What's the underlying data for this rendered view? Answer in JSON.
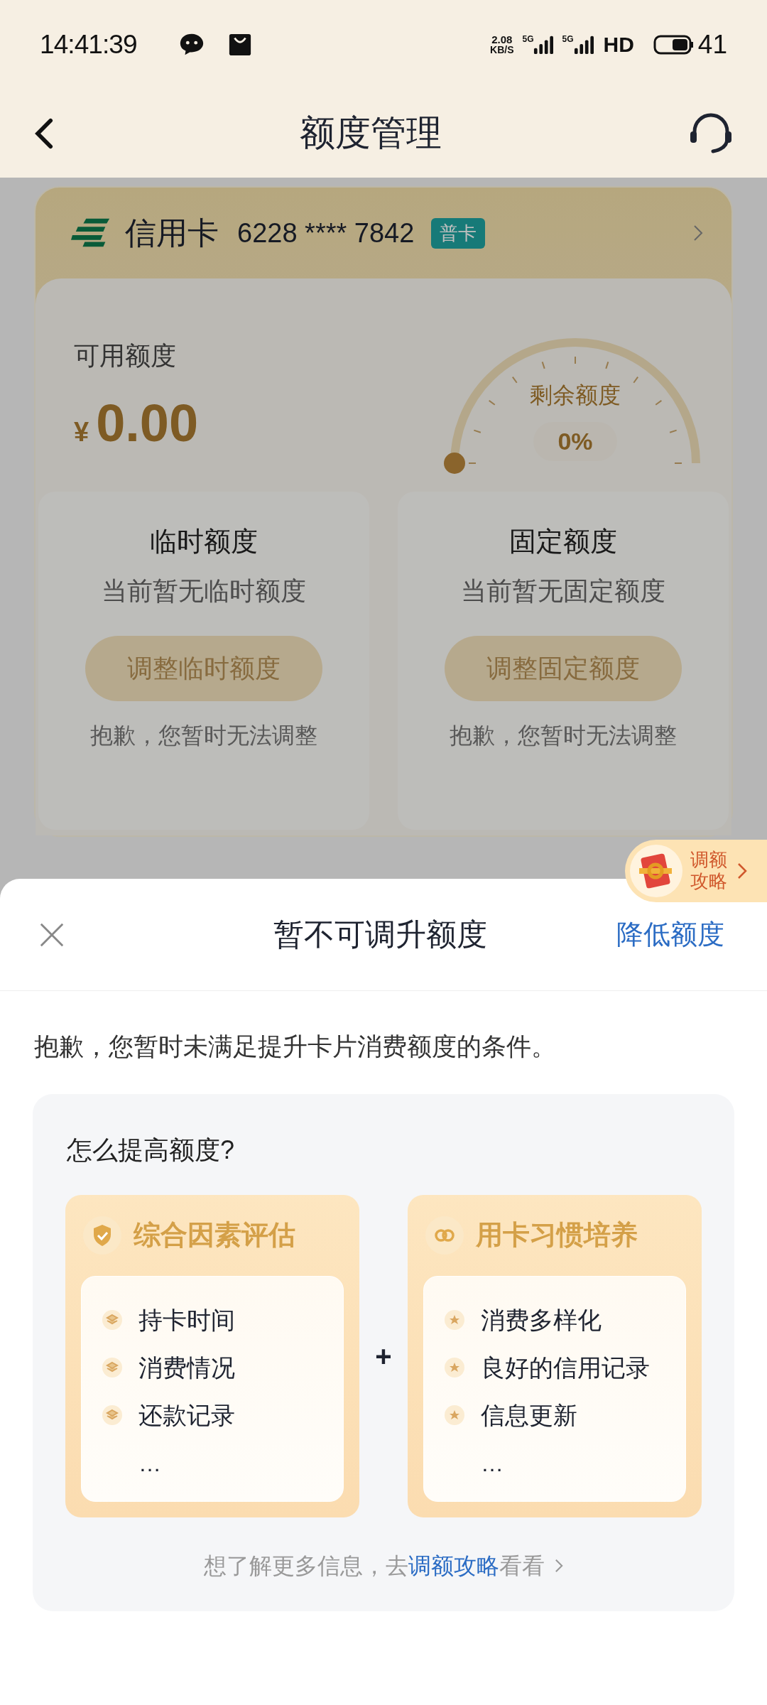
{
  "status_bar": {
    "time": "14:41:39",
    "speed_value": "2.08",
    "speed_unit": "KB/S",
    "networks": [
      "5G",
      "5G"
    ],
    "hd": "HD",
    "battery": "41"
  },
  "nav": {
    "title": "额度管理"
  },
  "card": {
    "title": "信用卡",
    "number": "6228 **** 7842",
    "badge": "普卡",
    "available_label": "可用额度",
    "currency": "¥",
    "amount": "0.00",
    "gauge": {
      "label": "剩余额度",
      "reading": "0%"
    },
    "limits": [
      {
        "title": "临时额度",
        "note": "当前暂无临时额度",
        "button": "调整临时额度",
        "disabled": true,
        "hint": "抱歉，您暂时无法调整"
      },
      {
        "title": "固定额度",
        "note": "当前暂无固定额度",
        "button": "调整固定额度",
        "disabled": true,
        "hint": "抱歉，您暂时无法调整"
      }
    ]
  },
  "float_tab": {
    "label": "调额攻略"
  },
  "sheet": {
    "title": "暂不可调升额度",
    "action": "降低额度",
    "message": "抱歉，您暂时未满足提升卡片消费额度的条件。",
    "tips": {
      "heading": "怎么提高额度?",
      "join": "+",
      "groups": [
        {
          "kind": "shield",
          "title": "综合因素评估",
          "items": [
            "持卡时间",
            "消费情况",
            "还款记录"
          ],
          "more": "…"
        },
        {
          "kind": "link",
          "title": "用卡习惯培养",
          "items": [
            "消费多样化",
            "良好的信用记录",
            "信息更新"
          ],
          "more": "…"
        }
      ]
    },
    "footer": {
      "prefix": "想了解更多信息，去",
      "link": "调额攻略",
      "suffix": "看看"
    }
  }
}
